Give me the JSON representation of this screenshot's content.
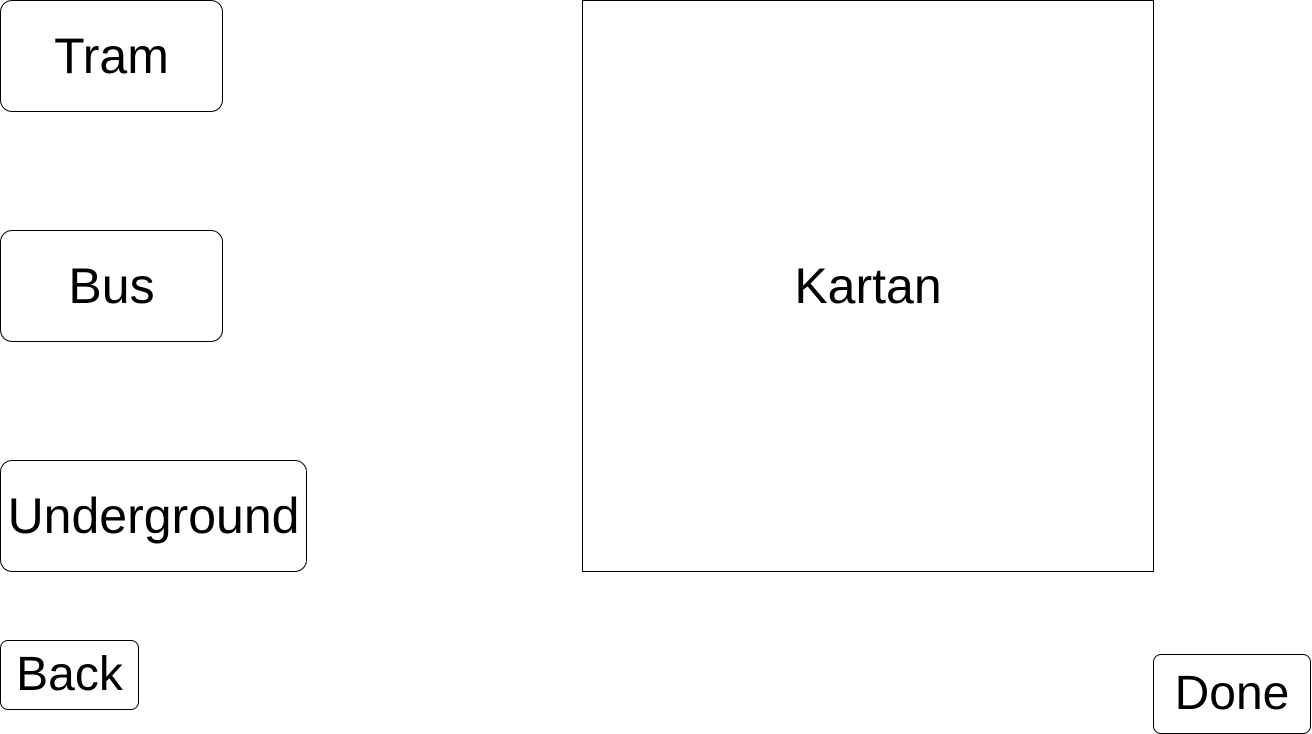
{
  "transport_modes": {
    "tram_label": "Tram",
    "bus_label": "Bus",
    "underground_label": "Underground"
  },
  "map": {
    "label": "Kartan"
  },
  "navigation": {
    "back_label": "Back",
    "done_label": "Done"
  },
  "colors": {
    "background": "#ffffff",
    "border": "#000000",
    "text": "#000000"
  }
}
